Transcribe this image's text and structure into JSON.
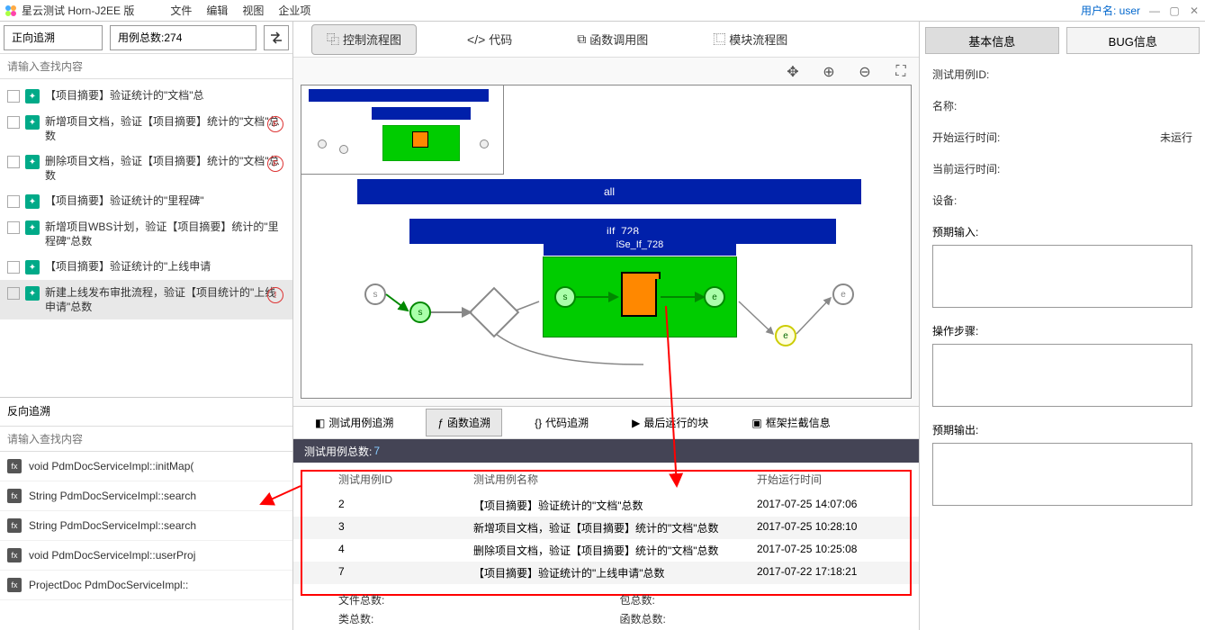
{
  "titlebar": {
    "title": "星云测试 Horn-J2EE 版",
    "menus": [
      "文件",
      "编辑",
      "视图",
      "企业项"
    ],
    "user_label": "用户名:",
    "user_name": "user"
  },
  "left": {
    "forward_label": "正向追溯",
    "total_label": "用例总数:",
    "total_value": "274",
    "search_placeholder": "请输入查找内容",
    "cases": [
      {
        "text": "【项目摘要】验证统计的\"文档\"总",
        "badge": ""
      },
      {
        "text": "新增项目文档，验证【项目摘要】统计的\"文档\"总数",
        "badge": "F"
      },
      {
        "text": "删除项目文档，验证【项目摘要】统计的\"文档\"总数",
        "badge": "F"
      },
      {
        "text": "【项目摘要】验证统计的\"里程碑\"",
        "badge": ""
      },
      {
        "text": "新增项目WBS计划，验证【项目摘要】统计的\"里程碑\"总数",
        "badge": ""
      },
      {
        "text": "【项目摘要】验证统计的\"上线申请",
        "badge": ""
      },
      {
        "text": "新建上线发布审批流程，验证【项目统计的\"上线申请\"总数",
        "badge": "!",
        "selected": true
      }
    ],
    "reverse_label": "反向追溯",
    "search2_placeholder": "请输入查找内容",
    "funcs": [
      "void PdmDocServiceImpl::initMap(",
      "String PdmDocServiceImpl::search",
      "String PdmDocServiceImpl::search",
      "void PdmDocServiceImpl::userProj",
      "ProjectDoc PdmDocServiceImpl::"
    ]
  },
  "center": {
    "tabs": [
      "控制流程图",
      "代码",
      "函数调用图",
      "模块流程图"
    ],
    "flow": {
      "all": "all",
      "if_label": "iIf_728",
      "se_label": "iSe_If_728"
    },
    "bottom_tabs": [
      "测试用例追溯",
      "函数追溯",
      "代码追溯",
      "最后运行的块",
      "框架拦截信息"
    ],
    "count_label": "测试用例总数:",
    "count_value": "7",
    "table": {
      "headers": [
        "测试用例ID",
        "测试用例名称",
        "开始运行时间"
      ],
      "rows": [
        {
          "id": "2",
          "name": "【项目摘要】验证统计的\"文档\"总数",
          "time": "2017-07-25 14:07:06"
        },
        {
          "id": "3",
          "name": "新增项目文档，验证【项目摘要】统计的\"文档\"总数",
          "time": "2017-07-25 10:28:10"
        },
        {
          "id": "4",
          "name": "删除项目文档，验证【项目摘要】统计的\"文档\"总数",
          "time": "2017-07-25 10:25:08"
        },
        {
          "id": "7",
          "name": "【项目摘要】验证统计的\"上线申请\"总数",
          "time": "2017-07-22 17:18:21"
        }
      ]
    },
    "summary": {
      "file_total": "文件总数:",
      "pkg_total": "包总数:",
      "class_total": "类总数:",
      "func_total": "函数总数:"
    }
  },
  "right": {
    "tabs": [
      "基本信息",
      "BUG信息"
    ],
    "fields": {
      "id_label": "测试用例ID:",
      "name_label": "名称:",
      "start_label": "开始运行时间:",
      "start_value": "未运行",
      "current_label": "当前运行时间:",
      "device_label": "设备:",
      "input_label": "预期输入:",
      "steps_label": "操作步骤:",
      "output_label": "预期输出:"
    }
  }
}
